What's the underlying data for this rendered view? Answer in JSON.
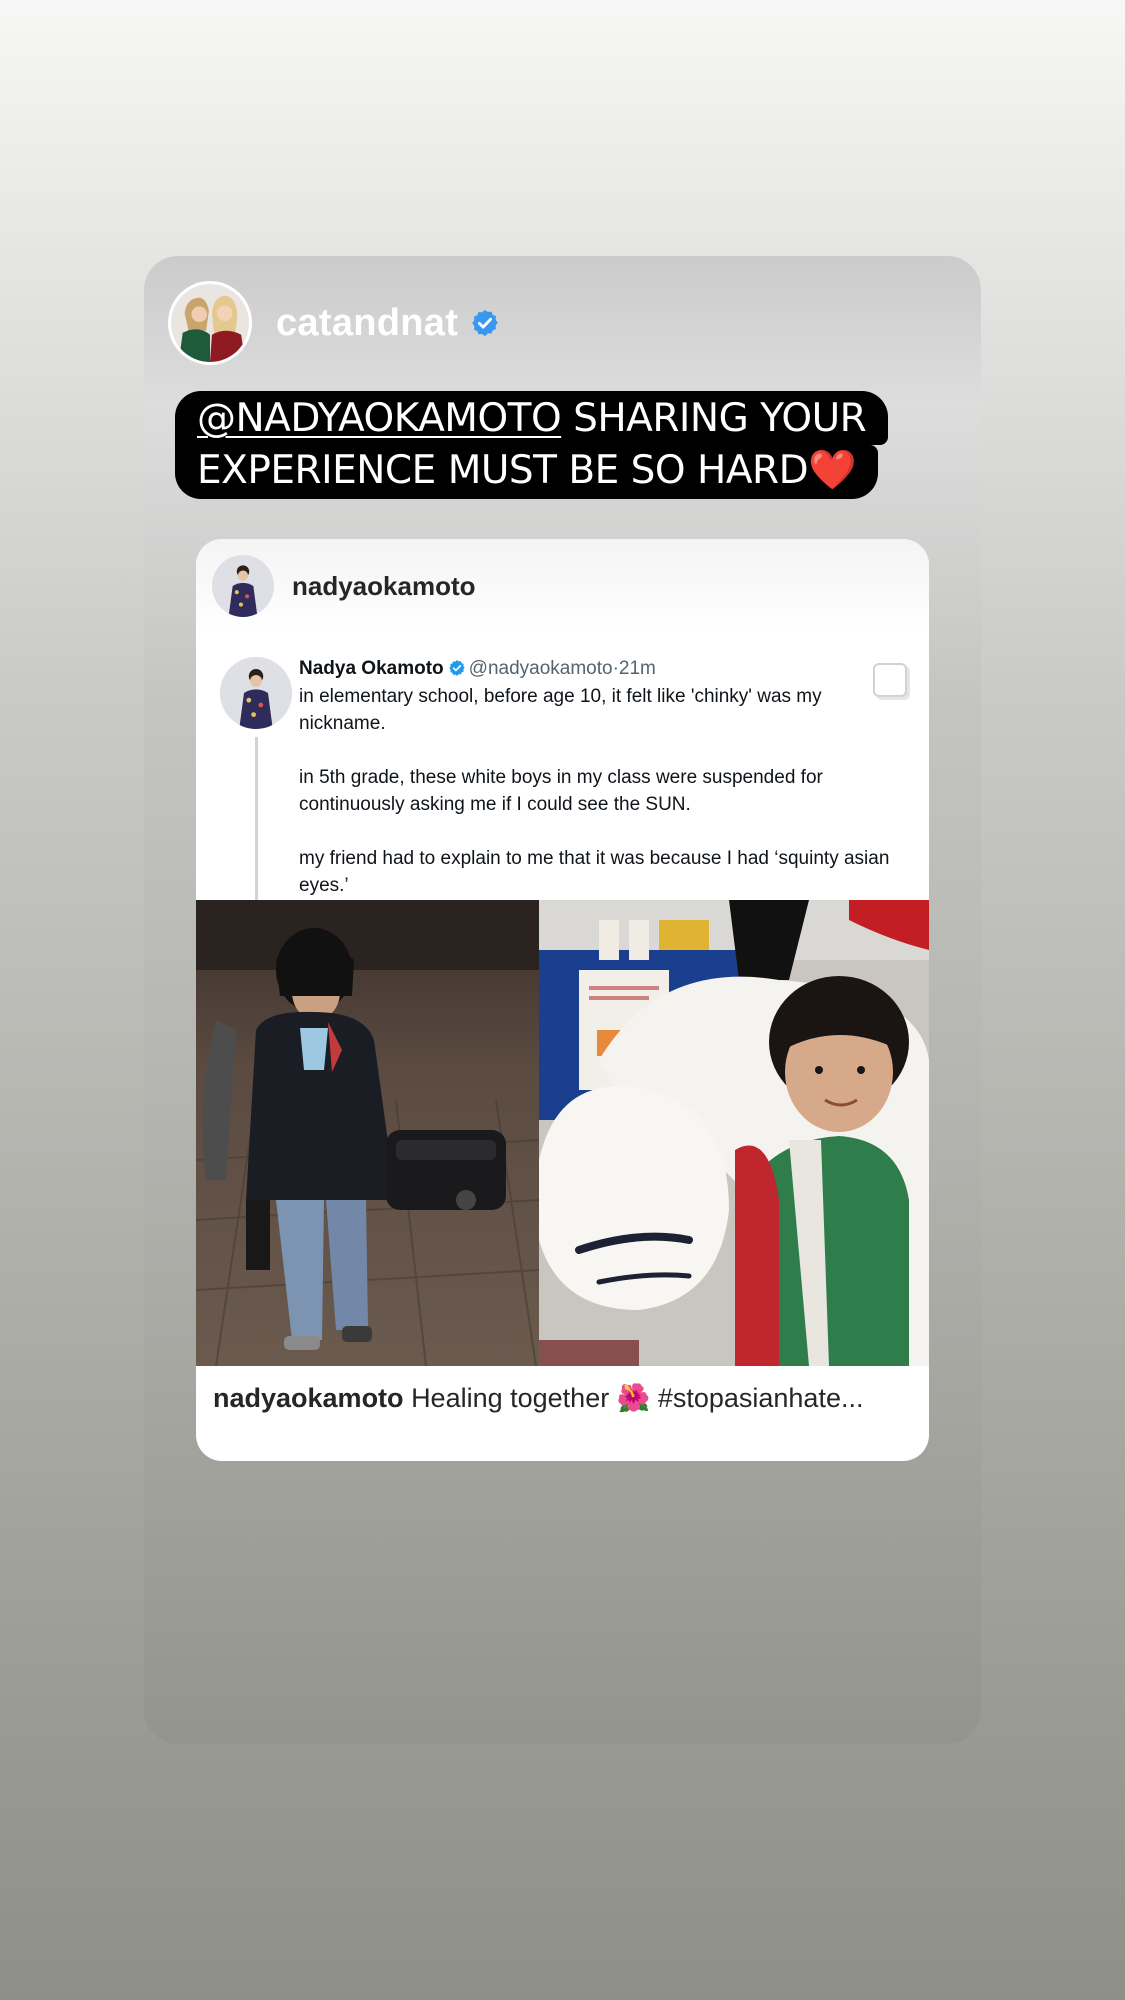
{
  "story": {
    "account": {
      "username": "catandnat",
      "verified_icon": "verified-badge-icon",
      "accent_color": "#3897f0"
    },
    "caption": {
      "mention": "@NADYAOKAMOTO",
      "line1_rest": " SHARING YOUR",
      "line2": "EXPERIENCE MUST BE SO HARD",
      "emoji": "❤️"
    }
  },
  "post": {
    "username": "nadyaokamoto",
    "tweet": {
      "name": "Nadya Okamoto",
      "handle": "@nadyaokamoto",
      "separator": "·",
      "time": "21m",
      "paragraphs": [
        "in elementary school, before age 10, it felt like 'chinky' was my nickname.",
        "in 5th grade, these white boys in my class were suspended for continuously asking me if I could see the SUN.",
        "my friend had to explain to me that it was because I had ‘squinty asian eyes.’"
      ]
    },
    "caption": {
      "username": "nadyaokamoto",
      "text": "Healing together 🌺 #stopasianhate..."
    }
  }
}
